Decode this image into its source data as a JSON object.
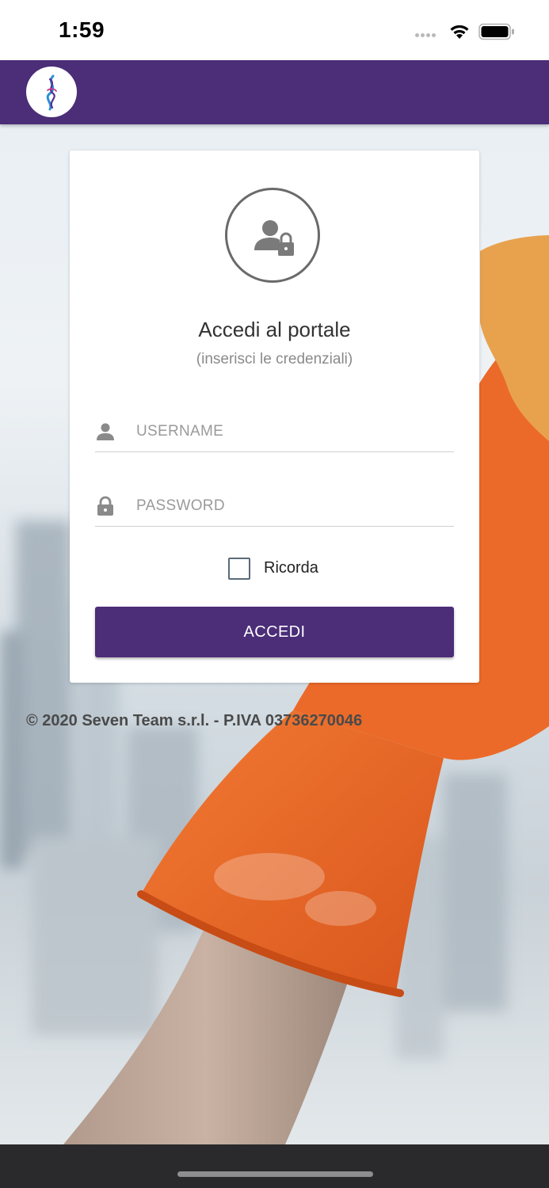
{
  "status_bar": {
    "time": "1:59"
  },
  "app_bar": {
    "logo_icon": "brand-logo-icon",
    "color": "#4b2d78"
  },
  "login": {
    "title": "Accedi al portale",
    "subtitle": "(inserisci le credenziali)",
    "username": {
      "placeholder": "USERNAME",
      "value": "",
      "icon": "user-icon"
    },
    "password": {
      "placeholder": "PASSWORD",
      "value": "",
      "icon": "lock-icon"
    },
    "remember_label": "Ricorda",
    "remember_checked": false,
    "submit_label": "ACCEDI"
  },
  "footer": {
    "text": "© 2020 Seven Team s.r.l. - P.IVA 03736270046"
  },
  "colors": {
    "primary": "#4b2d78",
    "glove": "#e8672a",
    "sponge": "#e9a24c"
  }
}
